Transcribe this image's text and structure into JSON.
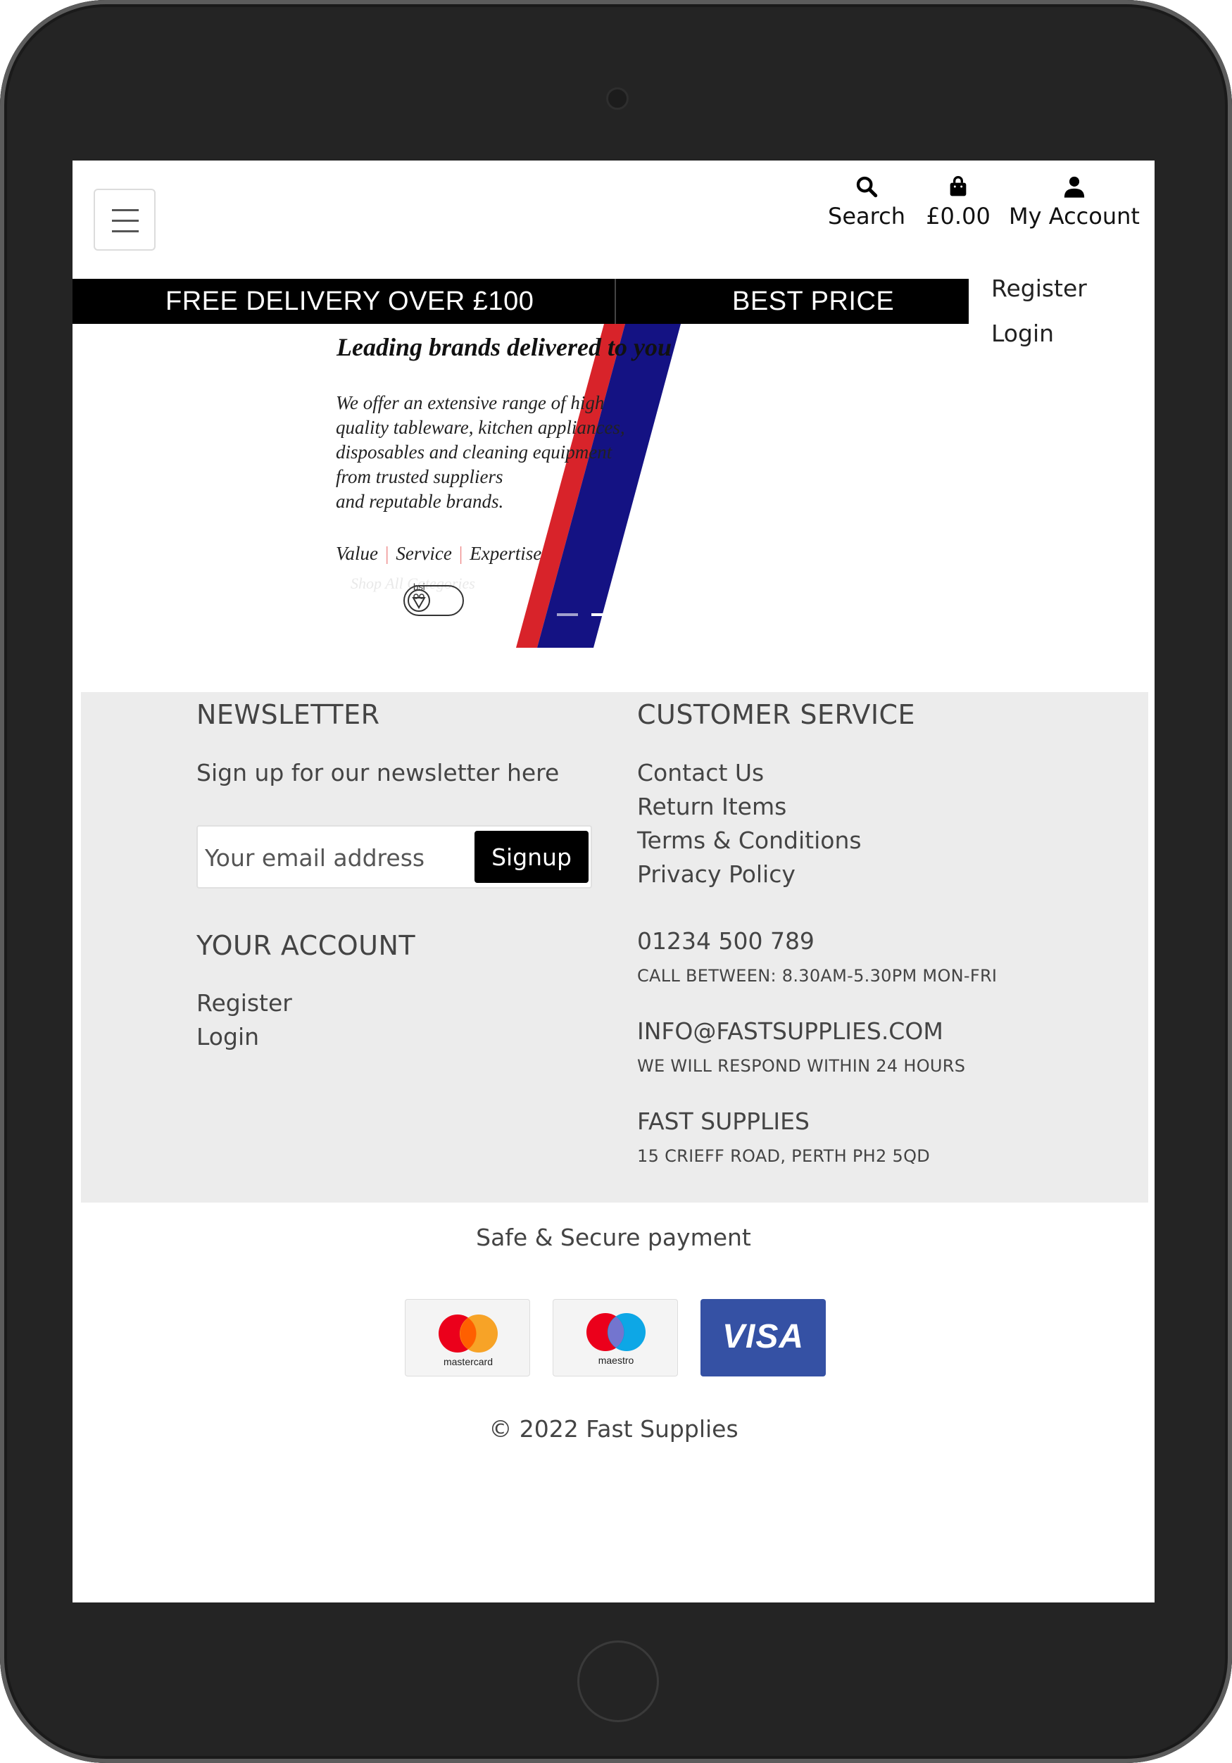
{
  "header": {
    "search_label": "Search",
    "cart_total": "£0.00",
    "account_label": "My Account",
    "account_menu": [
      "Register",
      "Login"
    ]
  },
  "banner": {
    "messages": [
      "FREE DELIVERY OVER £100",
      "BEST PRICE GUARA"
    ]
  },
  "hero": {
    "title": "Leading brands delivered to you",
    "body_lines": [
      "We offer an extensive range of high",
      "quality tableware, kitchen appliances,",
      "disposables and cleaning equipment",
      "from trusted suppliers",
      "and reputable brands."
    ],
    "values": [
      "Value",
      "Service",
      "Expertise"
    ],
    "shop_link": "Shop All Categories",
    "badge": "bsi",
    "slide_count": 2,
    "active_slide": 2,
    "colors": {
      "red": "#d8232a",
      "navy": "#141283"
    }
  },
  "newsletter": {
    "heading": "NEWSLETTER",
    "text": "Sign up for our newsletter here",
    "email_placeholder": "Your email address",
    "signup_label": "Signup"
  },
  "your_account": {
    "heading": "YOUR ACCOUNT",
    "links": [
      "Register",
      "Login"
    ]
  },
  "customer_service": {
    "heading": "CUSTOMER SERVICE",
    "links": [
      "Contact Us",
      "Return Items",
      "Terms & Conditions",
      "Privacy Policy"
    ],
    "phone": "01234 500 789",
    "phone_note": "CALL BETWEEN: 8.30AM-5.30PM MON-FRI",
    "email": "INFO@FASTSUPPLIES.COM",
    "email_note": "WE WILL RESPOND WITHIN 24 HOURS",
    "company": "FAST SUPPLIES",
    "address": "15 CRIEFF ROAD, PERTH PH2 5QD"
  },
  "payment": {
    "title": "Safe & Secure payment",
    "cards": [
      {
        "name": "mastercard",
        "label": "mastercard"
      },
      {
        "name": "maestro",
        "label": "maestro"
      },
      {
        "name": "visa",
        "label": "VISA"
      }
    ]
  },
  "footer": {
    "copyright": "© 2022 Fast Supplies"
  }
}
